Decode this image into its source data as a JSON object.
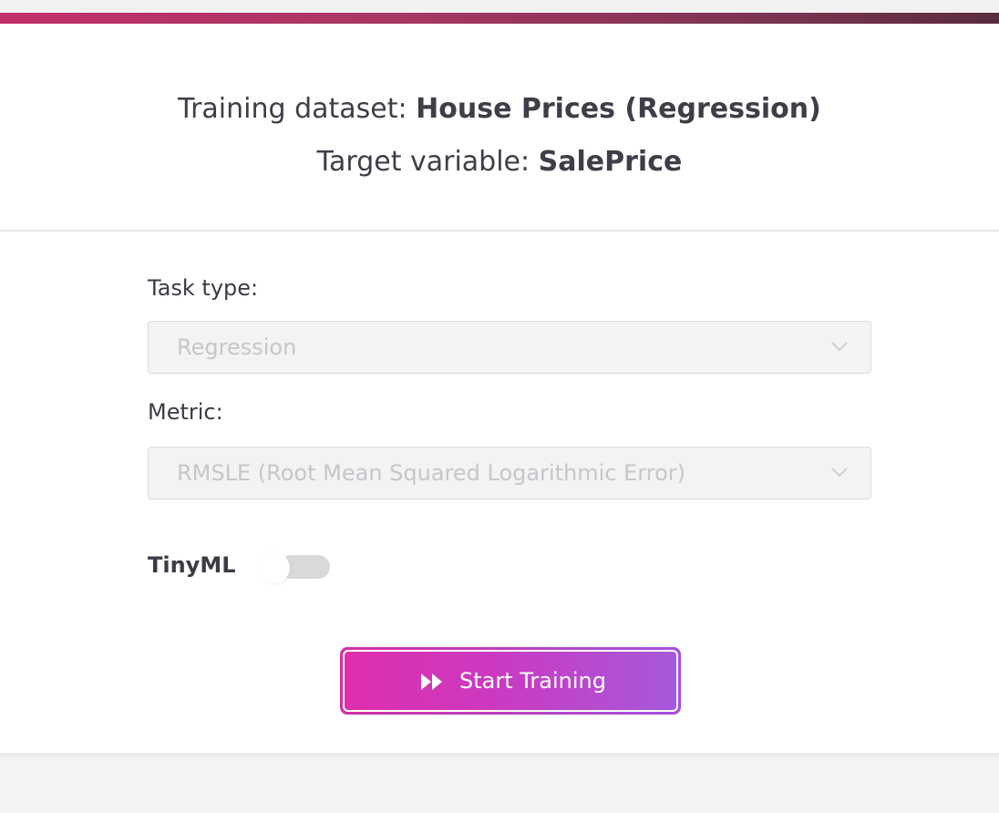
{
  "colors": {
    "accent_bar_start": "#c2306a",
    "accent_bar_end": "#5b2b3f",
    "button_start": "#df2fad",
    "button_end": "#a659db",
    "text": "#3e3e48"
  },
  "header": {
    "dataset_prefix": "Training dataset:",
    "dataset_name": "House Prices (Regression)",
    "target_prefix": "Target variable:",
    "target_name": "SalePrice"
  },
  "form": {
    "task_type": {
      "label": "Task type:",
      "value": "Regression",
      "disabled": true,
      "icon": "chevron-down-icon"
    },
    "metric": {
      "label": "Metric:",
      "value": "RMSLE (Root Mean Squared Logarithmic Error)",
      "disabled": true,
      "icon": "chevron-down-icon"
    },
    "tinyml": {
      "label": "TinyML",
      "enabled": false
    }
  },
  "actions": {
    "start_label": "Start Training",
    "start_icon": "fast-forward-icon"
  }
}
